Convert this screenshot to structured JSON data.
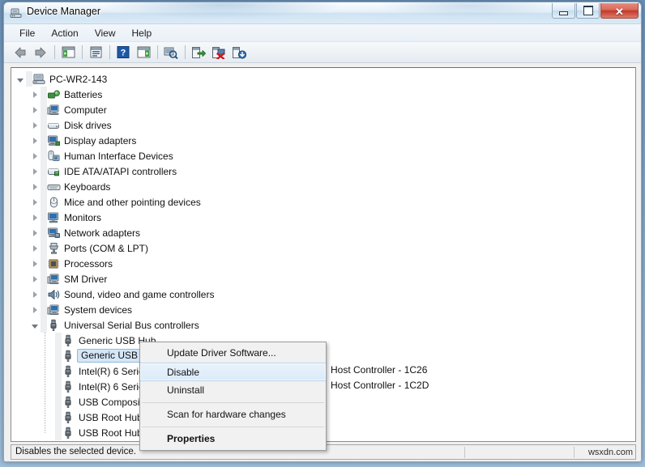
{
  "window": {
    "title": "Device Manager",
    "title_icon": "device-manager-icon",
    "buttons": {
      "minimize": "─",
      "maximize": "□",
      "close": "✕"
    }
  },
  "menubar": {
    "items": [
      {
        "label": "File"
      },
      {
        "label": "Action"
      },
      {
        "label": "View"
      },
      {
        "label": "Help"
      }
    ]
  },
  "toolbar": {
    "buttons": [
      {
        "name": "back-button",
        "icon": "back-arrow-icon"
      },
      {
        "name": "forward-button",
        "icon": "forward-arrow-icon"
      },
      {
        "name": "show-hide-console-tree-button",
        "icon": "console-tree-icon"
      },
      {
        "name": "properties-button",
        "icon": "properties-icon"
      },
      {
        "name": "help-button",
        "icon": "help-question-icon"
      },
      {
        "name": "show-hide-action-pane-button",
        "icon": "action-pane-icon"
      },
      {
        "name": "scan-for-hardware-changes-button",
        "icon": "scan-hardware-icon"
      },
      {
        "name": "update-driver-software-button",
        "icon": "update-driver-icon"
      },
      {
        "name": "disable-device-button",
        "icon": "disable-device-icon"
      },
      {
        "name": "uninstall-device-button",
        "icon": "uninstall-device-icon"
      }
    ]
  },
  "tree": {
    "root": {
      "label": "PC-WR2-143",
      "icon": "computer-root-icon",
      "expanded": true
    },
    "categories": [
      {
        "label": "Batteries",
        "icon": "battery-icon",
        "expanded": false
      },
      {
        "label": "Computer",
        "icon": "computer-icon",
        "expanded": false
      },
      {
        "label": "Disk drives",
        "icon": "disk-drive-icon",
        "expanded": false
      },
      {
        "label": "Display adapters",
        "icon": "display-adapter-icon",
        "expanded": false
      },
      {
        "label": "Human Interface Devices",
        "icon": "hid-icon",
        "expanded": false
      },
      {
        "label": "IDE ATA/ATAPI controllers",
        "icon": "ide-controller-icon",
        "expanded": false
      },
      {
        "label": "Keyboards",
        "icon": "keyboard-icon",
        "expanded": false
      },
      {
        "label": "Mice and other pointing devices",
        "icon": "mouse-icon",
        "expanded": false
      },
      {
        "label": "Monitors",
        "icon": "monitor-icon",
        "expanded": false
      },
      {
        "label": "Network adapters",
        "icon": "network-adapter-icon",
        "expanded": false
      },
      {
        "label": "Ports (COM & LPT)",
        "icon": "port-icon",
        "expanded": false
      },
      {
        "label": "Processors",
        "icon": "processor-icon",
        "expanded": false
      },
      {
        "label": "SM Driver",
        "icon": "sm-driver-icon",
        "expanded": false
      },
      {
        "label": "Sound, video and game controllers",
        "icon": "sound-controller-icon",
        "expanded": false
      },
      {
        "label": "System devices",
        "icon": "system-device-icon",
        "expanded": false
      },
      {
        "label": "Universal Serial Bus controllers",
        "icon": "usb-controller-icon",
        "expanded": true
      }
    ],
    "usb_devices": [
      {
        "label": "Generic USB Hub",
        "icon": "usb-device-icon",
        "selected": false
      },
      {
        "label": "Generic USB Hub",
        "icon": "usb-device-icon",
        "selected": true
      },
      {
        "label": "Intel(R) 6 Series/C200 Series Chipset Family USB Enhanced Host Controller - 1C26",
        "visible_prefix": "Intel(R) 6 Serie",
        "visible_suffix": "Host Controller - 1C26",
        "icon": "usb-device-icon",
        "selected": false
      },
      {
        "label": "Intel(R) 6 Series/C200 Series Chipset Family USB Enhanced Host Controller - 1C2D",
        "visible_prefix": "Intel(R) 6 Serie",
        "visible_suffix": "Host Controller - 1C2D",
        "icon": "usb-device-icon",
        "selected": false
      },
      {
        "label": "USB Composite Device",
        "visible_prefix": "USB Composi",
        "icon": "usb-device-icon",
        "selected": false
      },
      {
        "label": "USB Root Hub",
        "visible_prefix": "USB Root Hub",
        "icon": "usb-device-icon",
        "selected": false
      },
      {
        "label": "USB Root Hub",
        "visible_prefix": "USB Root Hub",
        "icon": "usb-device-icon",
        "selected": false
      }
    ]
  },
  "context_menu": {
    "items": [
      {
        "label": "Update Driver Software...",
        "highlighted": false,
        "bold": false
      },
      {
        "label": "Disable",
        "highlighted": true,
        "bold": false
      },
      {
        "label": "Uninstall",
        "highlighted": false,
        "bold": false
      },
      {
        "separator": true
      },
      {
        "label": "Scan for hardware changes",
        "highlighted": false,
        "bold": false
      },
      {
        "separator": true
      },
      {
        "label": "Properties",
        "highlighted": false,
        "bold": true
      }
    ]
  },
  "statusbar": {
    "text": "Disables the selected device.",
    "watermark": "wsxdn.com"
  },
  "colors": {
    "selection_fill": "#d4e6f7",
    "selection_border": "#8fb9dd",
    "menu_highlight": "#dcebf9",
    "close_button": "#c0392a",
    "window_bg": "#f0f0f0",
    "content_bg": "#ffffff"
  }
}
